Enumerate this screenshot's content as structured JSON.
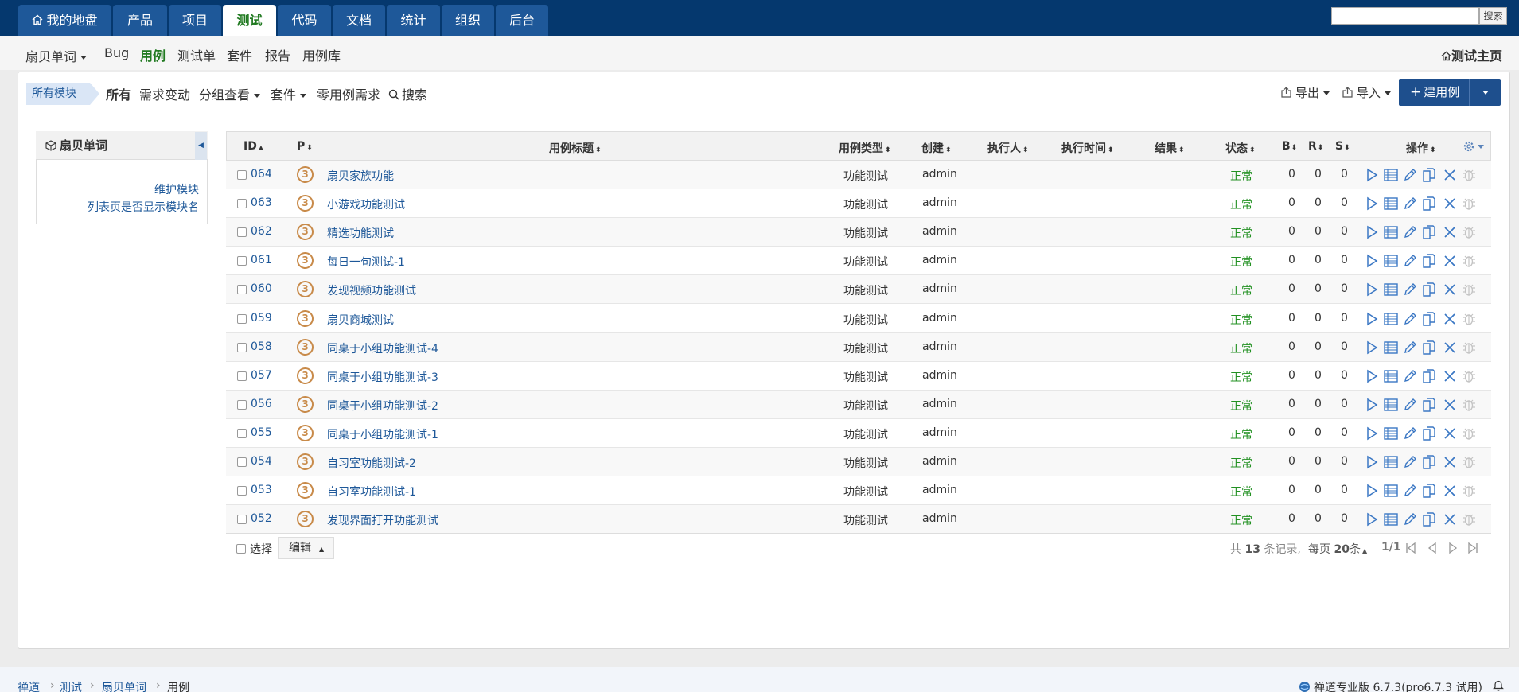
{
  "main_nav": {
    "tabs": [
      {
        "label": "我的地盘",
        "icon": "home-icon"
      },
      {
        "label": "产品"
      },
      {
        "label": "项目"
      },
      {
        "label": "测试"
      },
      {
        "label": "代码"
      },
      {
        "label": "文档"
      },
      {
        "label": "统计"
      },
      {
        "label": "组织"
      },
      {
        "label": "后台"
      }
    ],
    "active_tab": "测试",
    "search_button": "搜索"
  },
  "sub_nav": {
    "product_switcher": "扇贝单词",
    "items": [
      "Bug",
      "用例",
      "测试单",
      "套件",
      "报告",
      "用例库"
    ],
    "active_item": "用例",
    "home_link": "测试主页"
  },
  "filter_bar": {
    "module_badge": "所有模块",
    "filters": [
      "所有",
      "需求变动",
      "分组查看",
      "套件",
      "零用例需求",
      "搜索"
    ],
    "active_filter": "所有",
    "export_label": "导出",
    "import_label": "导入",
    "create_label": "建用例"
  },
  "sidebar": {
    "title": "扇贝单词",
    "links": [
      "维护模块",
      "列表页是否显示模块名"
    ]
  },
  "table": {
    "columns": [
      "ID",
      "P",
      "用例标题",
      "用例类型",
      "创建",
      "执行人",
      "执行时间",
      "结果",
      "状态",
      "B",
      "R",
      "S",
      "操作"
    ],
    "rows": [
      {
        "id": "064",
        "p": "3",
        "title": "扇贝家族功能",
        "type": "功能测试",
        "creator": "admin",
        "status": "正常",
        "b": "0",
        "r": "0",
        "s": "0"
      },
      {
        "id": "063",
        "p": "3",
        "title": "小游戏功能测试",
        "type": "功能测试",
        "creator": "admin",
        "status": "正常",
        "b": "0",
        "r": "0",
        "s": "0"
      },
      {
        "id": "062",
        "p": "3",
        "title": "精选功能测试",
        "type": "功能测试",
        "creator": "admin",
        "status": "正常",
        "b": "0",
        "r": "0",
        "s": "0"
      },
      {
        "id": "061",
        "p": "3",
        "title": "每日一句测试-1",
        "type": "功能测试",
        "creator": "admin",
        "status": "正常",
        "b": "0",
        "r": "0",
        "s": "0"
      },
      {
        "id": "060",
        "p": "3",
        "title": "发现视频功能测试",
        "type": "功能测试",
        "creator": "admin",
        "status": "正常",
        "b": "0",
        "r": "0",
        "s": "0"
      },
      {
        "id": "059",
        "p": "3",
        "title": "扇贝商城测试",
        "type": "功能测试",
        "creator": "admin",
        "status": "正常",
        "b": "0",
        "r": "0",
        "s": "0"
      },
      {
        "id": "058",
        "p": "3",
        "title": "同桌于小组功能测试-4",
        "type": "功能测试",
        "creator": "admin",
        "status": "正常",
        "b": "0",
        "r": "0",
        "s": "0"
      },
      {
        "id": "057",
        "p": "3",
        "title": "同桌于小组功能测试-3",
        "type": "功能测试",
        "creator": "admin",
        "status": "正常",
        "b": "0",
        "r": "0",
        "s": "0"
      },
      {
        "id": "056",
        "p": "3",
        "title": "同桌于小组功能测试-2",
        "type": "功能测试",
        "creator": "admin",
        "status": "正常",
        "b": "0",
        "r": "0",
        "s": "0"
      },
      {
        "id": "055",
        "p": "3",
        "title": "同桌于小组功能测试-1",
        "type": "功能测试",
        "creator": "admin",
        "status": "正常",
        "b": "0",
        "r": "0",
        "s": "0"
      },
      {
        "id": "054",
        "p": "3",
        "title": "自习室功能测试-2",
        "type": "功能测试",
        "creator": "admin",
        "status": "正常",
        "b": "0",
        "r": "0",
        "s": "0"
      },
      {
        "id": "053",
        "p": "3",
        "title": "自习室功能测试-1",
        "type": "功能测试",
        "creator": "admin",
        "status": "正常",
        "b": "0",
        "r": "0",
        "s": "0"
      },
      {
        "id": "052",
        "p": "3",
        "title": "发现界面打开功能测试",
        "type": "功能测试",
        "creator": "admin",
        "status": "正常",
        "b": "0",
        "r": "0",
        "s": "0"
      }
    ],
    "row_actions": [
      "run-icon",
      "results-icon",
      "edit-icon",
      "copy-icon",
      "delete-icon",
      "bug-icon"
    ]
  },
  "table_footer": {
    "select_label": "选择",
    "edit_label": "编辑",
    "total_prefix": "共",
    "total_count": "13",
    "total_suffix": "条记录,",
    "per_page_prefix": "每页",
    "per_page": "20",
    "per_page_suffix": "条",
    "page_info": "1/1"
  },
  "breadcrumb": [
    "禅道",
    "测试",
    "扇贝单词",
    "用例"
  ],
  "version_text": "禅道专业版 6.7.3(pro6.7.3 试用)",
  "colors": {
    "topbar": "#05386e",
    "tab": "#1e5899",
    "active_green": "#217a21",
    "link_blue": "#1e5899",
    "status_green": "#229122",
    "priority": "#c88a49",
    "primary_button": "#1e4f8d"
  }
}
